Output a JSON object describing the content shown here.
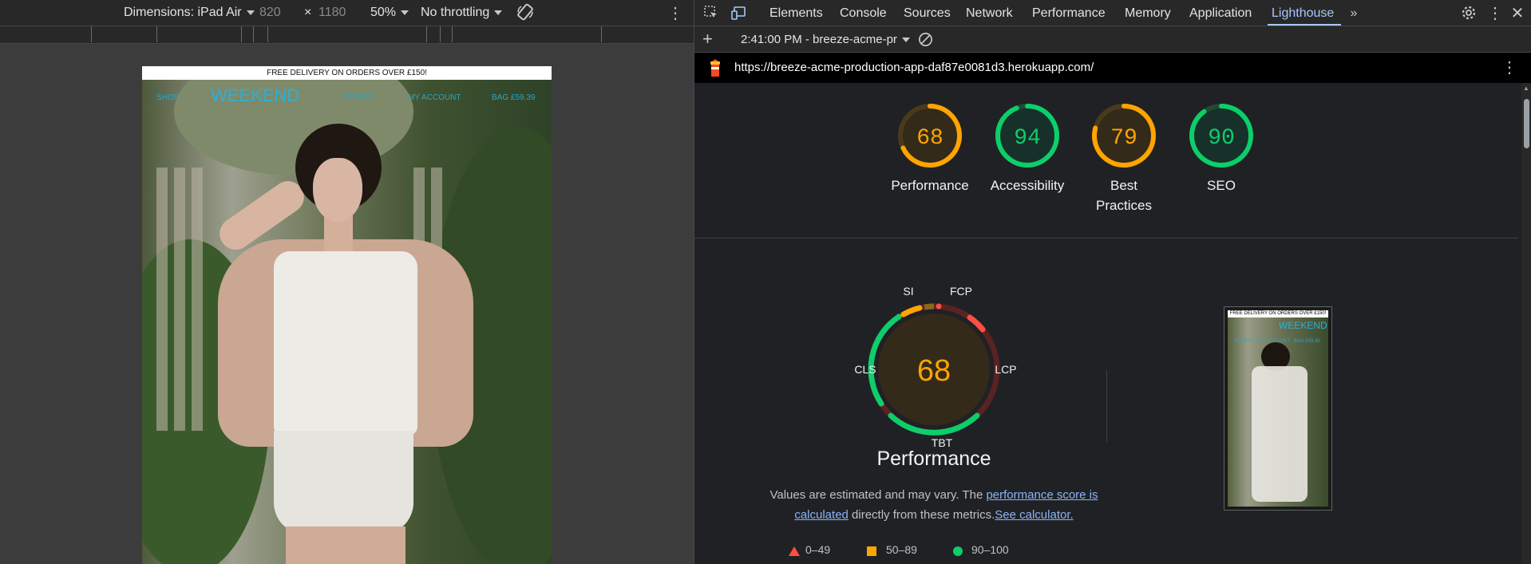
{
  "device_toolbar": {
    "dimensions_label": "Dimensions: iPad Air",
    "width": "820",
    "times": "×",
    "height": "1180",
    "zoom": "50%",
    "throttling": "No throttling"
  },
  "site": {
    "promo": "FREE DELIVERY ON ORDERS OVER £150!",
    "nav_shop": "SHOP",
    "logo": "WEEKEND",
    "nav_search": "SEARCH",
    "nav_account": "MY ACCOUNT",
    "nav_bag": "BAG £59.39"
  },
  "devtools": {
    "tabs": [
      "Elements",
      "Console",
      "Sources",
      "Network",
      "Performance",
      "Memory",
      "Application",
      "Lighthouse"
    ],
    "active_tab": "Lighthouse",
    "report_time": "2:41:00 PM - breeze-acme-pr",
    "url": "https://breeze-acme-production-app-daf87e0081d3.herokuapp.com/"
  },
  "scores": [
    {
      "label": "Performance",
      "value": 68,
      "color": "#ffa400"
    },
    {
      "label": "Accessibility",
      "value": 94,
      "color": "#0cce6b"
    },
    {
      "label": "Best Practices",
      "value": 79,
      "color": "#ffa400"
    },
    {
      "label": "SEO",
      "value": 90,
      "color": "#0cce6b"
    }
  ],
  "performance": {
    "score": "68",
    "title": "Performance",
    "metrics": {
      "si": "SI",
      "fcp": "FCP",
      "cls": "CLS",
      "lcp": "LCP",
      "tbt": "TBT"
    },
    "note_prefix": "Values are estimated and may vary. The ",
    "note_link1": "performance score is calculated",
    "note_mid": " directly from these metrics.",
    "note_link2": "See calculator."
  },
  "legend": {
    "red": "0–49",
    "orange": "50–89",
    "green": "90–100"
  },
  "colors": {
    "red": "#ff4e42",
    "orange": "#ffa400",
    "green": "#0cce6b",
    "accent": "#a8c7fa"
  }
}
